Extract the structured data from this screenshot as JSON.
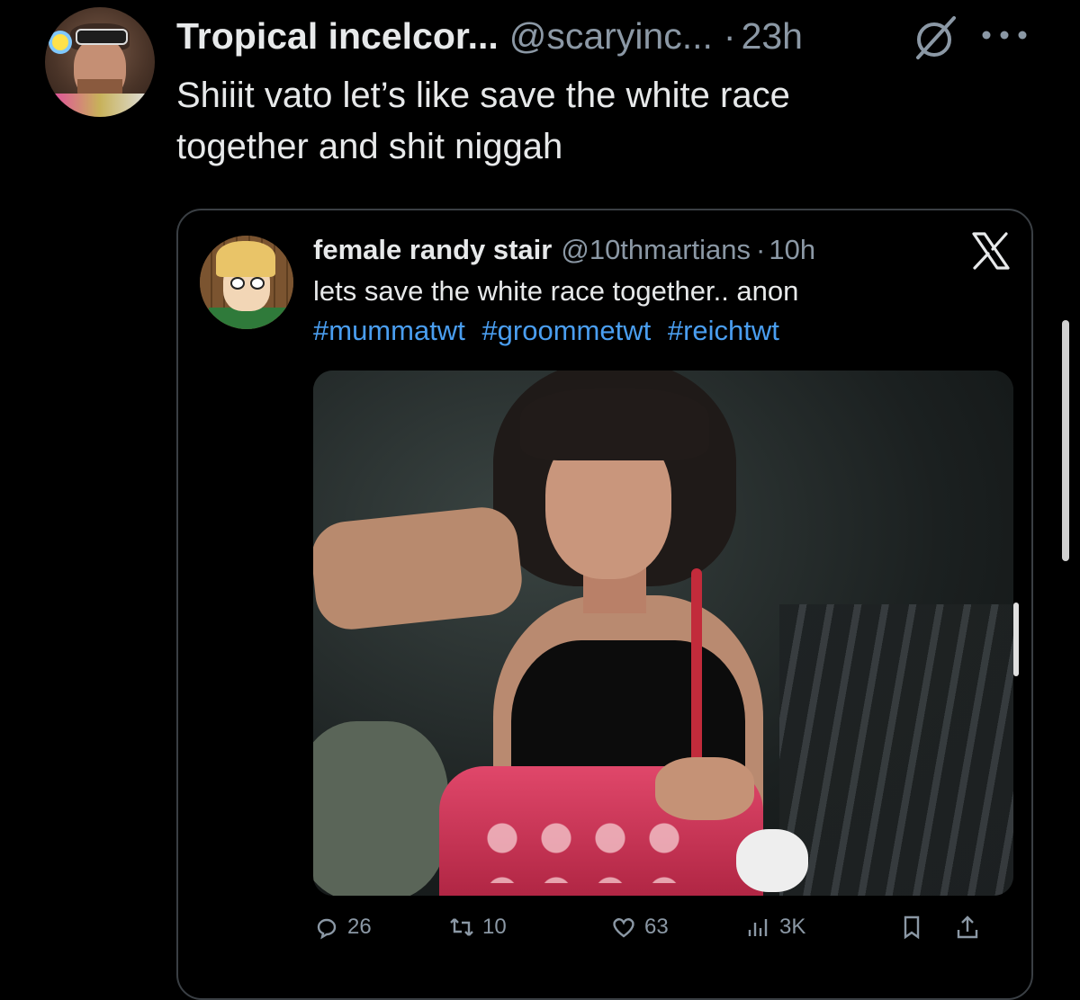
{
  "post": {
    "name": "Tropical incelcor...",
    "handle": "@scaryinc...",
    "separator": "·",
    "time": "23h",
    "text_line1": "Shiiit vato let’s like save the white race",
    "text_line2": "together and shit niggah"
  },
  "quote": {
    "name": "female randy stair",
    "handle": "@10thmartians",
    "separator": "·",
    "time": "10h",
    "text": "lets save the white race together.. anon",
    "hashtags": [
      "#mummatwt",
      "#groommetwt",
      "#reichtwt"
    ],
    "stats": {
      "replies": "26",
      "reposts": "10",
      "likes": "63",
      "views": "3K"
    }
  },
  "icons": {
    "grok": "grok-icon",
    "more": "more-icon",
    "platform": "x-logo-icon",
    "reply": "reply-icon",
    "repost": "repost-icon",
    "like": "heart-icon",
    "views": "views-icon",
    "bookmark": "bookmark-icon",
    "share": "share-icon"
  },
  "colors": {
    "background": "#000000",
    "text": "#e7e9ea",
    "muted": "#8b98a5",
    "link": "#4a9ef0",
    "border": "#3a3f44"
  }
}
